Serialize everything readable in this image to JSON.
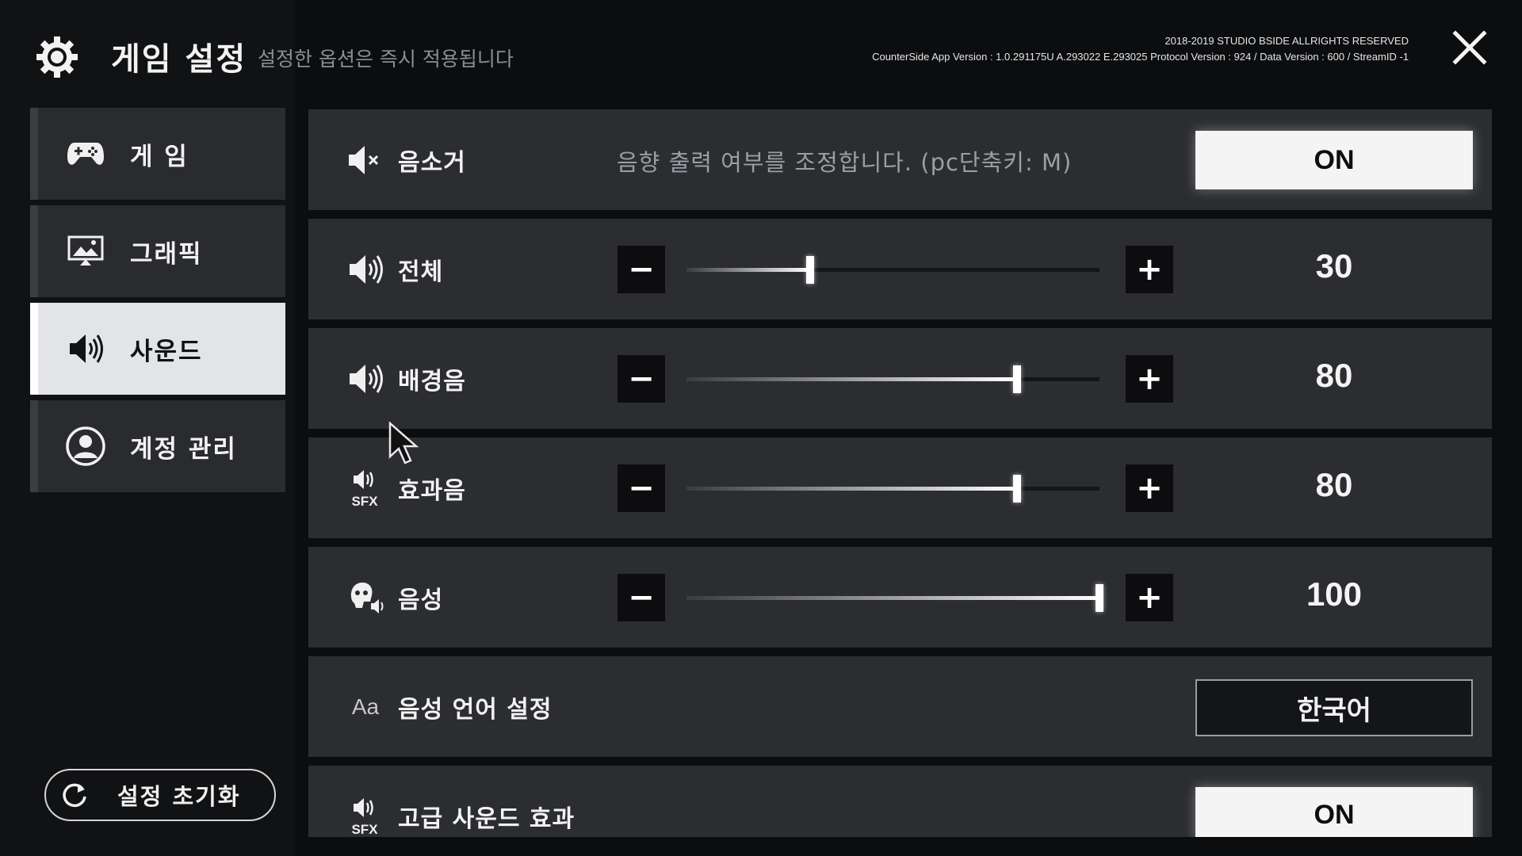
{
  "header": {
    "title": "게임 설정",
    "subtitle": "설정한 옵션은 즉시 적용됩니다",
    "copyright": "2018-2019 STUDIO BSIDE ALLRIGHTS RESERVED",
    "version": "CounterSide App Version : 1.0.291175U A.293022 E.293025 Protocol Version : 924 / Data Version : 600 / StreamID -1",
    "icons": {
      "settings": "gear-icon",
      "close": "close-icon"
    }
  },
  "sidebar": {
    "items": [
      {
        "label": "게 임",
        "icon": "gamepad-icon",
        "active": false
      },
      {
        "label": "그래픽",
        "icon": "monitor-icon",
        "active": false
      },
      {
        "label": "사운드",
        "icon": "speaker-icon",
        "active": true
      },
      {
        "label": "계정 관리",
        "icon": "user-icon",
        "active": false
      }
    ],
    "reset_label": "설정 초기화"
  },
  "sound": {
    "mute": {
      "label": "음소거",
      "description": "음향 출력 여부를 조정합니다. (pc단축키: M)",
      "toggle": "ON",
      "icon": "speaker-mute-icon"
    },
    "sliders": [
      {
        "key": "master",
        "label": "전체",
        "value": 30,
        "display": "30",
        "icon": "speaker-icon"
      },
      {
        "key": "bgm",
        "label": "배경음",
        "value": 80,
        "display": "80",
        "icon": "speaker-icon"
      },
      {
        "key": "sfx",
        "label": "효과음",
        "value": 80,
        "display": "80",
        "icon": "sfx-icon"
      },
      {
        "key": "voice",
        "label": "음성",
        "value": 100,
        "display": "100",
        "icon": "voice-icon"
      }
    ],
    "voice_language": {
      "label": "음성 언어 설정",
      "value": "한국어",
      "icon_text": "Aa"
    },
    "advanced": {
      "label": "고급 사운드 효과",
      "toggle": "ON",
      "icon": "sfx-icon"
    },
    "sfx_icon_text": "SFX",
    "minus_symbol": "−",
    "plus_symbol": "+"
  },
  "colors": {
    "background": "#0c0d0f",
    "panel": "#2b2d31",
    "active_menu": "#e2e4e8",
    "toggle_on": "#f4f4f4"
  }
}
